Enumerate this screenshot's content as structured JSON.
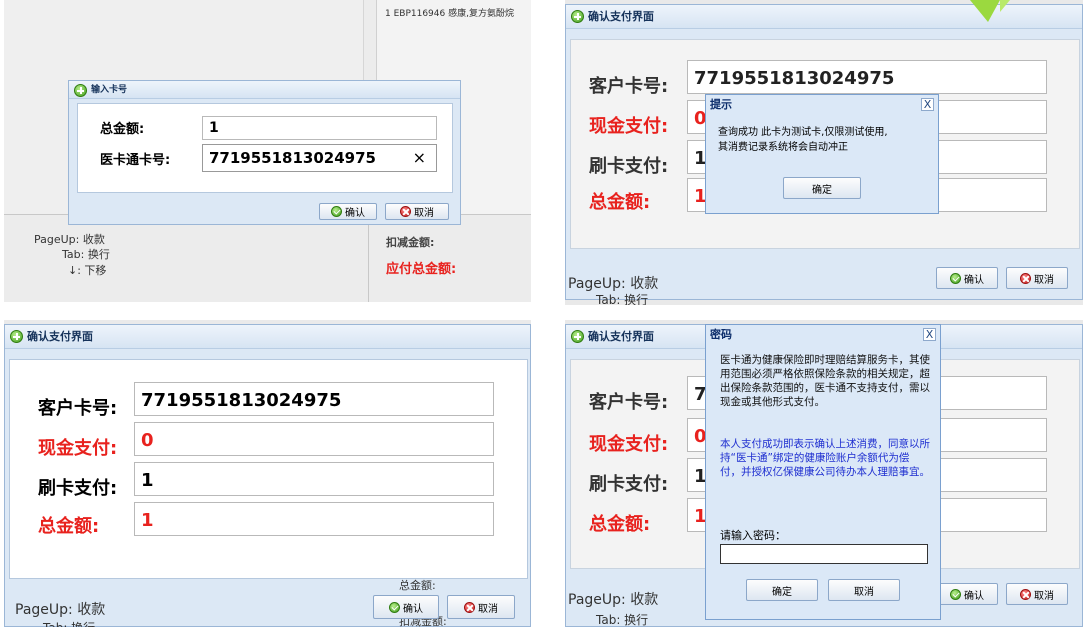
{
  "panel1": {
    "list_row": "1 EBP116946 感康,复方氨酚烷",
    "dialog_title": "输入卡号",
    "total_label": "总金额:",
    "total_value": "1",
    "card_label": "医卡通卡号:",
    "card_value": "7719551813024975",
    "clear_glyph": "×",
    "ok_label": "确认",
    "cancel_label": "取消",
    "hint_pageup": "PageUp: 收款",
    "hint_tab": "Tab: 换行",
    "hint_down": "↓: 下移",
    "deduct_label": "扣减金额:",
    "payable_label": "应付总金额:"
  },
  "panel2": {
    "dialog_title": "确认支付界面",
    "card_label": "客户卡号:",
    "card_value": "7719551813024975",
    "cash_label": "现金支付:",
    "cash_value": "0",
    "swipe_label": "刷卡支付:",
    "swipe_value": "1",
    "total_label": "总金额:",
    "total_value": "1",
    "popup_title": "提示",
    "popup_line1": "查询成功 此卡为测试卡,仅限测试使用,",
    "popup_line2": "其消费记录系统将会自动冲正",
    "popup_ok": "确定",
    "close_glyph": "X",
    "ok_label": "确认",
    "cancel_label": "取消",
    "faint_pageup": "PageUp: 收款",
    "faint_tab": "Tab: 换行"
  },
  "panel3": {
    "dialog_title": "确认支付界面",
    "card_label": "客户卡号:",
    "card_value": "7719551813024975",
    "cash_label": "现金支付:",
    "cash_value": "0",
    "swipe_label": "刷卡支付:",
    "swipe_value": "1",
    "total_label": "总金额:",
    "total_value": "1",
    "ok_label": "确认",
    "cancel_label": "取消",
    "faint_pageup": "PageUp: 收款",
    "faint_tab": "Tab: 换行",
    "faint_total": "总金额:",
    "faint_deduct": "扣减金额:"
  },
  "panel4": {
    "dialog_title": "确认支付界面",
    "card_label": "客户卡号:",
    "card_partial": "7",
    "cash_label": "现金支付:",
    "cash_partial": "0",
    "swipe_label": "刷卡支付:",
    "swipe_partial": "1",
    "total_label": "总金额:",
    "total_partial": "1",
    "popup_title": "密码",
    "close_glyph": "X",
    "para1": "医卡通为健康保险即时理赔结算服务卡，其使用范围必须严格依照保险条款的相关规定，超出保险条款范围的，医卡通不支持支付，需以现金或其他形式支付。",
    "para2": "本人支付成功即表示确认上述消费，同意以所持“医卡通”绑定的健康险账户余额代为偿付，并授权亿保健康公司待办本人理赔事宜。",
    "pwd_label": "请输入密码：",
    "pwd_value": "",
    "popup_ok": "确定",
    "popup_cancel": "取消",
    "ok_label": "确认",
    "cancel_label": "取消",
    "faint_pageup": "PageUp: 收款",
    "faint_tab": "Tab: 换行"
  },
  "colors": {
    "accent_red": "#e8221e",
    "frame_blue": "#9bb6d6",
    "blue_text": "#1f2fd0"
  }
}
